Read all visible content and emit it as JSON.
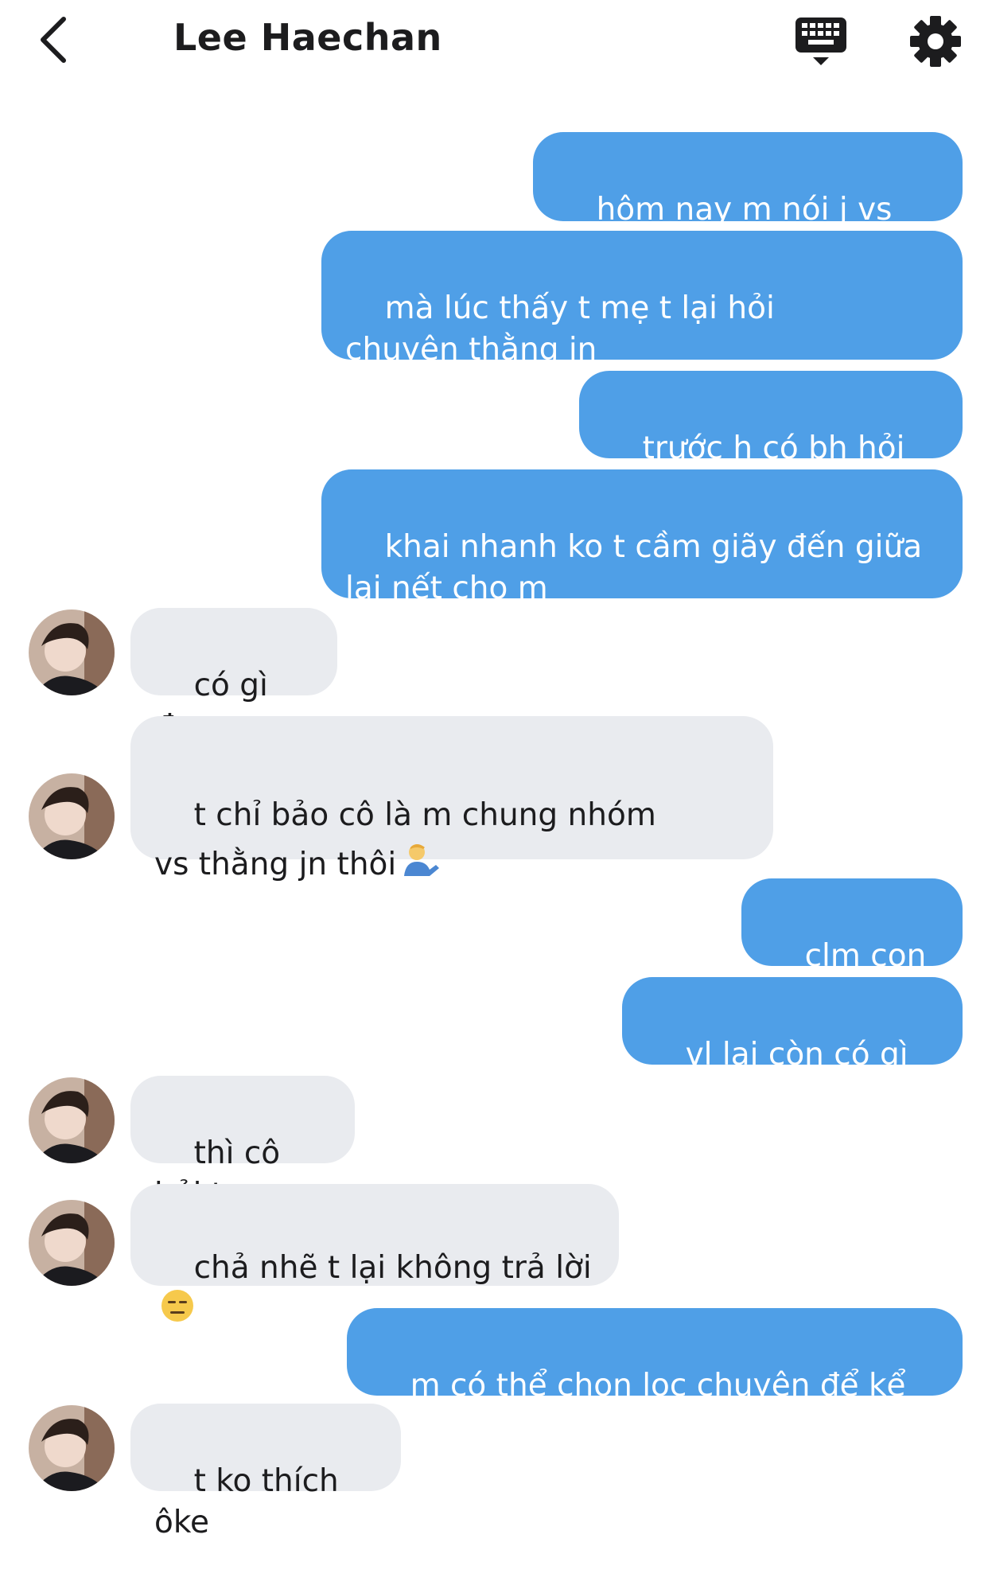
{
  "header": {
    "title": "Lee Haechan",
    "back_icon": "chevron-left-icon",
    "keyboard_icon": "keyboard-icon",
    "settings_icon": "gear-icon"
  },
  "colors": {
    "outgoing_bubble": "#4f9fe7",
    "incoming_bubble": "#e9ebef"
  },
  "messages": [
    {
      "from": "me",
      "text": "hôm nay m nói j vs mẹ t"
    },
    {
      "from": "me",
      "text": "mà lúc thấy t mẹ t lại hỏi chuyện thằng jn"
    },
    {
      "from": "me",
      "text": "trước h có bh hỏi đâu"
    },
    {
      "from": "me",
      "text": "khai nhanh ko t cầm giãy đến giữa lại nết cho m"
    },
    {
      "from": "them",
      "text": "có gì đou"
    },
    {
      "from": "them",
      "text": "t chỉ bảo cô là m chung nhóm vs thằng jn thôi",
      "emoji": "person-tipping-hand-emoji"
    },
    {
      "from": "me",
      "text": "clm con tr*"
    },
    {
      "from": "me",
      "text": "vl lại còn có gì đâu"
    },
    {
      "from": "them",
      "text": "thì cô hỏi t"
    },
    {
      "from": "them",
      "text": "chả nhẽ t lại không trả lời",
      "emoji": "expressionless-face-emoji"
    },
    {
      "from": "me",
      "text": "m có thể chọn lọc chuyện để kể mà"
    },
    {
      "from": "them",
      "text": "t ko thích ôke"
    }
  ]
}
